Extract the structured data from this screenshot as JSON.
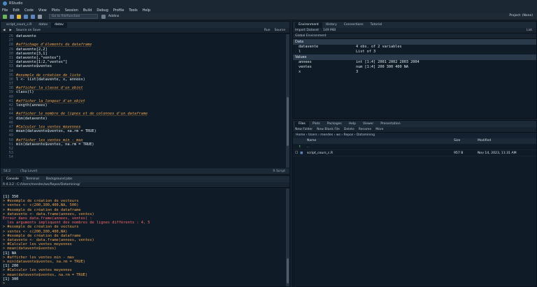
{
  "app": {
    "title": "RStudio",
    "project": "Project: (None)"
  },
  "menu": [
    "File",
    "Edit",
    "Code",
    "View",
    "Plots",
    "Session",
    "Build",
    "Debug",
    "Profile",
    "Tools",
    "Help"
  ],
  "toolbar": {
    "goto_placeholder": "Go to file/function",
    "addins": "Addins"
  },
  "editor": {
    "tabs": [
      {
        "label": "script_cours_c.R"
      },
      {
        "label": "datav"
      },
      {
        "label": "datav"
      }
    ],
    "source_on_save": "Source on Save",
    "run": "Run",
    "source": "Source",
    "status_pos": "54:2",
    "status_level": "(Top Level)",
    "status_type": "R Script",
    "lines": [
      {
        "n": "26",
        "kind": "txt",
        "text": "datavente"
      },
      {
        "n": "27",
        "kind": "txt",
        "text": ""
      },
      {
        "n": "28",
        "kind": "cmt",
        "text": "#affichage d'élements du dataframe"
      },
      {
        "n": "29",
        "kind": "txt",
        "text": "datavente[2,2]"
      },
      {
        "n": "30",
        "kind": "txt",
        "text": "datavente[3,1]"
      },
      {
        "n": "31",
        "kind": "txt",
        "text": "datavente[,\"ventes\"]"
      },
      {
        "n": "32",
        "kind": "txt",
        "text": "datavente[1:2,\"ventes\"]"
      },
      {
        "n": "33",
        "kind": "txt",
        "text": "datavente$ventes"
      },
      {
        "n": "34",
        "kind": "txt",
        "text": ""
      },
      {
        "n": "35",
        "kind": "cmt",
        "text": "#exemple de création de liste"
      },
      {
        "n": "36",
        "kind": "txt",
        "text": "l <- list(datavente, x, annees)"
      },
      {
        "n": "37",
        "kind": "txt",
        "text": ""
      },
      {
        "n": "38",
        "kind": "cmt",
        "text": "#afficher la classe d'un objet"
      },
      {
        "n": "39",
        "kind": "txt",
        "text": "class(l)"
      },
      {
        "n": "40",
        "kind": "txt",
        "text": ""
      },
      {
        "n": "41",
        "kind": "cmt",
        "text": "#afficher la longeur d'un objet"
      },
      {
        "n": "42",
        "kind": "txt",
        "text": "length(annees)"
      },
      {
        "n": "43",
        "kind": "txt",
        "text": ""
      },
      {
        "n": "44",
        "kind": "cmt",
        "text": "#afficher le nombre de lignes et de colonnes d'un dataframe"
      },
      {
        "n": "45",
        "kind": "txt",
        "text": "dim(datavente)"
      },
      {
        "n": "46",
        "kind": "txt",
        "text": ""
      },
      {
        "n": "47",
        "kind": "cmt",
        "text": "#Calculer les ventes moyennes"
      },
      {
        "n": "48",
        "kind": "txt",
        "text": "mean(datavente$ventes, na.rm = TRUE)"
      },
      {
        "n": "49",
        "kind": "txt",
        "text": ""
      },
      {
        "n": "50",
        "kind": "cmt",
        "text": "#afficher les ventes min - max"
      },
      {
        "n": "51",
        "kind": "txt",
        "text": "min(datavente$ventes, na.rm = TRUE)"
      },
      {
        "n": "52",
        "kind": "txt",
        "text": ""
      },
      {
        "n": "53",
        "kind": "txt",
        "text": ""
      },
      {
        "n": "54",
        "kind": "txt",
        "text": ""
      }
    ]
  },
  "console": {
    "tabs": [
      {
        "label": "Console"
      },
      {
        "label": "Terminal"
      },
      {
        "label": "Background Jobs"
      }
    ],
    "path": "R 4.3.2 · C:/Users/mendes/ws/Repos/Datamining/",
    "lines": [
      {
        "kind": "out",
        "text": "[1] 350"
      },
      {
        "kind": "prompt",
        "text": "> #exemple de création de vecteurs"
      },
      {
        "kind": "prompt",
        "text": "> ventes <- c(200,300,400,NA, 500)"
      },
      {
        "kind": "prompt",
        "text": "> #exemple de création de dataframe"
      },
      {
        "kind": "prompt",
        "text": "> datavente <- data.frame(annees, ventes)"
      },
      {
        "kind": "err",
        "text": "Erreur dans data.frame(annees, ventes) :"
      },
      {
        "kind": "err",
        "text": "  les arguments impliquent des nombres de lignes différents : 4, 5"
      },
      {
        "kind": "prompt",
        "text": "> #exemple de création de vecteurs"
      },
      {
        "kind": "prompt",
        "text": "> ventes <- c(200,300,400,NA)"
      },
      {
        "kind": "prompt",
        "text": "> #exemple de création de dataframe"
      },
      {
        "kind": "prompt",
        "text": "> datavente <- data.frame(annees, ventes)"
      },
      {
        "kind": "prompt",
        "text": "> #Calculer les ventes moyennes"
      },
      {
        "kind": "prompt",
        "text": "> mean(datavente$ventes)"
      },
      {
        "kind": "out",
        "text": "[1] NA"
      },
      {
        "kind": "prompt",
        "text": "> #afficher les ventes min - max"
      },
      {
        "kind": "prompt",
        "text": "> min(datavente$ventes, na.rm = TRUE)"
      },
      {
        "kind": "out",
        "text": "[1] 200"
      },
      {
        "kind": "prompt",
        "text": "> #Calculer les ventes moyennes"
      },
      {
        "kind": "prompt",
        "text": "> mean(datavente$ventes, na.rm = TRUE)"
      },
      {
        "kind": "out",
        "text": "[1] 300"
      },
      {
        "kind": "prompt",
        "text": ">"
      }
    ]
  },
  "environment": {
    "tabs": [
      {
        "label": "Environment"
      },
      {
        "label": "History"
      },
      {
        "label": "Connections"
      },
      {
        "label": "Tutorial"
      }
    ],
    "import": "Import Dataset",
    "memory": "149 MiB",
    "list_view": "List",
    "scope": "Global Environment",
    "data_header": "Data",
    "values_header": "Values",
    "data": [
      {
        "name": "datavente",
        "value": "4 obs. of 2 variables"
      },
      {
        "name": "l",
        "value": "List of 3"
      }
    ],
    "values": [
      {
        "name": "annees",
        "value": "int [1:4] 2001 2002 2003 2004"
      },
      {
        "name": "ventes",
        "value": "num [1:4] 200 300 400 NA"
      },
      {
        "name": "x",
        "value": "3"
      }
    ]
  },
  "files": {
    "tabs": [
      {
        "label": "Files"
      },
      {
        "label": "Plots"
      },
      {
        "label": "Packages"
      },
      {
        "label": "Help"
      },
      {
        "label": "Viewer"
      },
      {
        "label": "Presentation"
      }
    ],
    "actions": [
      "New Folder",
      "New Blank File",
      "Delete",
      "Rename",
      "More"
    ],
    "path": "Home › Users › mendes › ws › Repos › Datamining",
    "columns": {
      "name": "Name",
      "size": "Size",
      "modified": "Modified"
    },
    "rows": [
      {
        "name": "..",
        "size": "",
        "modified": ""
      },
      {
        "name": "script_cours_c.R",
        "size": "957 B",
        "modified": "Nov 14, 2023, 11:31 AM"
      }
    ]
  }
}
